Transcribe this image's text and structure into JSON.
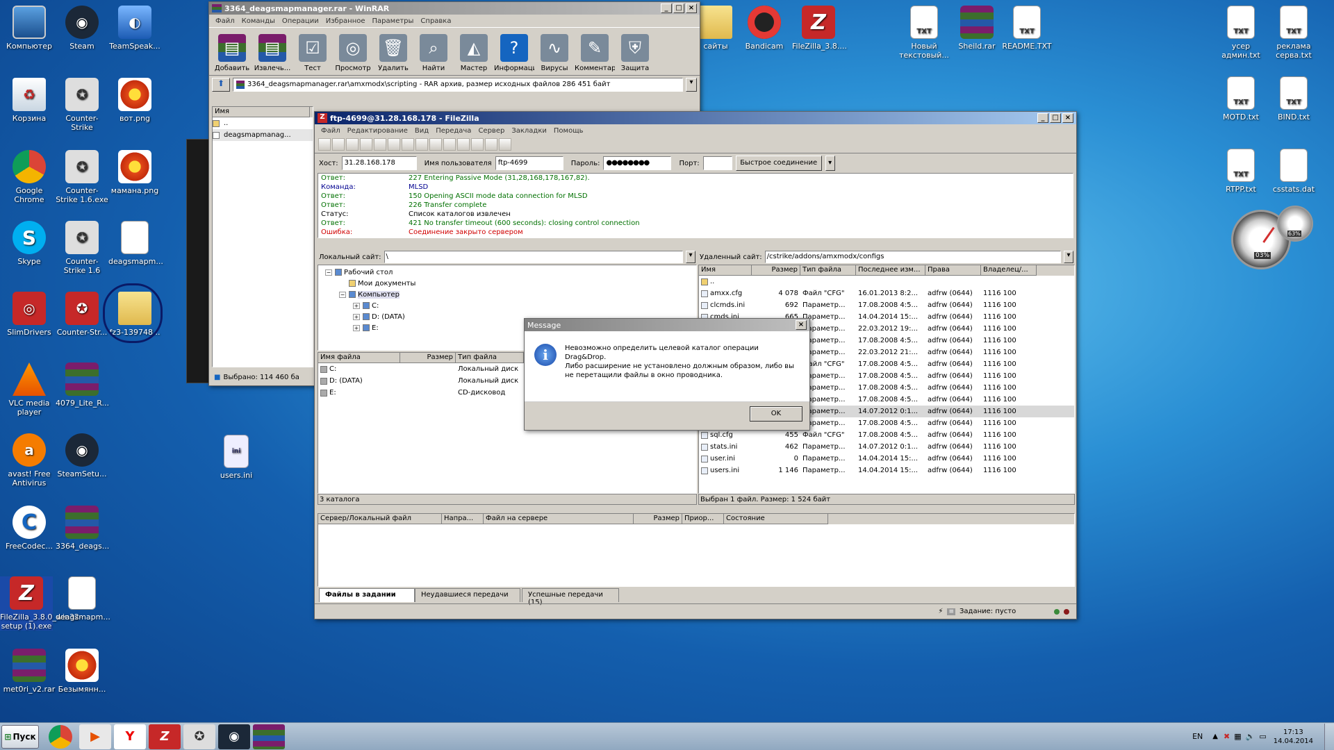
{
  "desktop_left": [
    {
      "id": "computer",
      "label": "Компьютер",
      "icon": "computer-icon",
      "cls": "mon",
      "glyph": ""
    },
    {
      "id": "steam",
      "label": "Steam",
      "icon": "steam-icon",
      "cls": "steam",
      "glyph": "◉"
    },
    {
      "id": "teamspeak",
      "label": "TeamSpeak...",
      "icon": "teamspeak-icon",
      "cls": "blue",
      "glyph": "◐"
    },
    {
      "id": "recycle",
      "label": "Корзина",
      "icon": "recycle-bin-icon",
      "cls": "trash",
      "glyph": "♻"
    },
    {
      "id": "cs",
      "label": "Counter-Strike",
      "icon": "counter-strike-icon",
      "cls": "cs",
      "glyph": "✪"
    },
    {
      "id": "vot",
      "label": "вот.png",
      "icon": "image-file-icon",
      "cls": "flower",
      "glyph": ""
    },
    {
      "id": "chrome",
      "label": "Google Chrome",
      "icon": "chrome-icon",
      "cls": "chrome",
      "glyph": ""
    },
    {
      "id": "cs16",
      "label": "Counter-Strike 1.6.exe",
      "icon": "counter-strike-icon",
      "cls": "cs",
      "glyph": "✪"
    },
    {
      "id": "mama",
      "label": "мамана.png",
      "icon": "image-file-icon",
      "cls": "flower",
      "glyph": ""
    },
    {
      "id": "skype",
      "label": "Skype",
      "icon": "skype-icon",
      "cls": "skype",
      "glyph": "S"
    },
    {
      "id": "cs16b",
      "label": "Counter-Strike 1.6",
      "icon": "counter-strike-icon",
      "cls": "cs",
      "glyph": "✪"
    },
    {
      "id": "deags",
      "label": "deagsmapm...",
      "icon": "file-icon",
      "cls": "file",
      "glyph": ""
    },
    {
      "id": "slim",
      "label": "SlimDrivers",
      "icon": "slimdrivers-icon",
      "cls": "red",
      "glyph": "◎"
    },
    {
      "id": "cstr",
      "label": "Counter-Str...",
      "icon": "counter-strike-icon",
      "cls": "red",
      "glyph": "✪"
    },
    {
      "id": "fz3",
      "label": "fz3-139748...",
      "icon": "folder-icon",
      "cls": "folder",
      "glyph": ""
    },
    {
      "id": "vlc",
      "label": "VLC media player",
      "icon": "vlc-icon",
      "cls": "vlc",
      "glyph": ""
    },
    {
      "id": "lite",
      "label": "4079_Lite_R...",
      "icon": "winrar-archive-icon",
      "cls": "rar",
      "glyph": ""
    },
    {
      "id": "avast",
      "label": "avast! Free Antivirus",
      "icon": "avast-icon",
      "cls": "avast",
      "glyph": "a"
    },
    {
      "id": "steamsetup",
      "label": "SteamSetu...",
      "icon": "steam-icon",
      "cls": "steam",
      "glyph": "◉"
    },
    {
      "id": "freecodec",
      "label": "FreeCodec...",
      "icon": "freecodec-icon",
      "cls": "cc",
      "glyph": "C"
    },
    {
      "id": "deagsrar",
      "label": "3364_deags...",
      "icon": "winrar-archive-icon",
      "cls": "rar",
      "glyph": ""
    },
    {
      "id": "fzsetup",
      "label": "FileZilla_3.8.0_win32-setup (1).exe",
      "icon": "filezilla-icon",
      "cls": "fz",
      "glyph": "Z"
    },
    {
      "id": "deagsmap2",
      "label": "deagsmapm...",
      "icon": "file-icon",
      "cls": "file",
      "glyph": ""
    },
    {
      "id": "met0ri",
      "label": "met0ri_v2.rar",
      "icon": "winrar-archive-icon",
      "cls": "rar",
      "glyph": ""
    },
    {
      "id": "bezym",
      "label": "Безымянн...",
      "icon": "image-file-icon",
      "cls": "flower",
      "glyph": ""
    },
    {
      "id": "usersini",
      "label": "users.ini",
      "icon": "ini-file-icon",
      "cls": "ini",
      "glyph": "ini"
    }
  ],
  "desktop_top": [
    {
      "id": "saity",
      "label": "сайты",
      "icon": "folder-icon",
      "cls": "folder",
      "glyph": ""
    },
    {
      "id": "bandicam",
      "label": "Bandicam",
      "icon": "bandicam-icon",
      "cls": "bandi",
      "glyph": ""
    },
    {
      "id": "fz38",
      "label": "FileZilla_3.8....",
      "icon": "filezilla-icon",
      "cls": "fz",
      "glyph": "Z"
    },
    {
      "id": "newtxt",
      "label": "Новый текстовый...",
      "icon": "txt-file-icon",
      "cls": "txt",
      "glyph": "TXT"
    },
    {
      "id": "sheild",
      "label": "Sheild.rar",
      "icon": "winrar-archive-icon",
      "cls": "rar",
      "glyph": ""
    },
    {
      "id": "readme",
      "label": "README.TXT",
      "icon": "txt-file-icon",
      "cls": "txt",
      "glyph": "TXT"
    },
    {
      "id": "usery",
      "label": "усер админ.txt",
      "icon": "txt-file-icon",
      "cls": "txt",
      "glyph": "TXT"
    },
    {
      "id": "reklama",
      "label": "реклама серва.txt",
      "icon": "txt-file-icon",
      "cls": "txt",
      "glyph": "TXT"
    },
    {
      "id": "motd",
      "label": "MOTD.txt",
      "icon": "txt-file-icon",
      "cls": "txt",
      "glyph": "TXT"
    },
    {
      "id": "bind",
      "label": "BIND.txt",
      "icon": "txt-file-icon",
      "cls": "txt",
      "glyph": "TXT"
    },
    {
      "id": "rtpp",
      "label": "RTPP.txt",
      "icon": "txt-file-icon",
      "cls": "txt",
      "glyph": "TXT"
    },
    {
      "id": "csstats",
      "label": "csstats.dat",
      "icon": "file-icon",
      "cls": "file",
      "glyph": ""
    }
  ],
  "gadget": {
    "cpu": "03%",
    "ram": "63%"
  },
  "winrar": {
    "title": "3364_deagsmapmanager.rar - WinRAR",
    "menu": [
      "Файл",
      "Команды",
      "Операции",
      "Избранное",
      "Параметры",
      "Справка"
    ],
    "toolbar": [
      "Добавить",
      "Извлечь...",
      "Тест",
      "Просмотр",
      "Удалить",
      "Найти",
      "Мастер",
      "Информация",
      "Вирусы",
      "Комментарий",
      "Защита"
    ],
    "path": "3364_deagsmapmanager.rar\\amxmodx\\scripting - RAR архив, размер исходных файлов 286 451 байт",
    "col_name": "Имя",
    "files": [
      "..",
      "deagsmapmanag..."
    ],
    "status": "Выбрано: 114 460 ба"
  },
  "filezilla": {
    "title": "ftp-4699@31.28.168.178 - FileZilla",
    "menu": [
      "Файл",
      "Редактирование",
      "Вид",
      "Передача",
      "Сервер",
      "Закладки",
      "Помощь"
    ],
    "host_label": "Хост:",
    "host": "31.28.168.178",
    "user_label": "Имя пользователя",
    "user": "ftp-4699",
    "pass_label": "Пароль:",
    "pass": "●●●●●●●●",
    "port_label": "Порт:",
    "port": "",
    "connect": "Быстрое соединение",
    "log": [
      {
        "k": "Ответ:",
        "v": "227 Entering Passive Mode (31,28,168,178,167,82).",
        "c": "#007000"
      },
      {
        "k": "Команда:",
        "v": "MLSD",
        "c": "#000090"
      },
      {
        "k": "Ответ:",
        "v": "150 Opening ASCII mode data connection for MLSD",
        "c": "#007000"
      },
      {
        "k": "Ответ:",
        "v": "226 Transfer complete",
        "c": "#007000"
      },
      {
        "k": "Статус:",
        "v": "Список каталогов извлечен",
        "c": "#000000"
      },
      {
        "k": "Ответ:",
        "v": "421 No transfer timeout (600 seconds): closing control connection",
        "c": "#007000"
      },
      {
        "k": "Ошибка:",
        "v": "Соединение закрыто сервером",
        "c": "#d00000"
      }
    ],
    "local_label": "Локальный сайт:",
    "local_path": "\\",
    "tree": [
      {
        "t": "Рабочий стол",
        "d": 0
      },
      {
        "t": "Мои документы",
        "d": 1
      },
      {
        "t": "Компьютер",
        "d": 1
      },
      {
        "t": "C:",
        "d": 2
      },
      {
        "t": "D: (DATA)",
        "d": 2
      },
      {
        "t": "E:",
        "d": 2
      }
    ],
    "local_cols": [
      "Имя файла",
      "Размер",
      "Тип файла"
    ],
    "local_files": [
      [
        "C:",
        "",
        "Локальный диск"
      ],
      [
        "D: (DATA)",
        "",
        "Локальный диск"
      ],
      [
        "E:",
        "",
        "CD-дисковод"
      ]
    ],
    "local_status": "3 каталога",
    "remote_label": "Удаленный сайт:",
    "remote_path": "/cstrike/addons/amxmodx/configs",
    "remote_cols": [
      "Имя",
      "Размер",
      "Тип файла",
      "Последнее изм...",
      "Права",
      "Владелец/..."
    ],
    "remote_files": [
      [
        "..",
        "",
        "",
        "",
        "",
        ""
      ],
      [
        "amxx.cfg",
        "4 078",
        "Файл \"CFG\"",
        "16.01.2013 8:2...",
        "adfrw (0644)",
        "1116 100"
      ],
      [
        "clcmds.ini",
        "692",
        "Параметр...",
        "17.08.2008 4:5...",
        "adfrw (0644)",
        "1116 100"
      ],
      [
        "cmds.ini",
        "665",
        "Параметр...",
        "14.04.2014 15:...",
        "adfrw (0644)",
        "1116 100"
      ],
      [
        "",
        "",
        "Параметр...",
        "22.03.2012 19:...",
        "adfrw (0644)",
        "1116 100"
      ],
      [
        "",
        "",
        "Параметр...",
        "17.08.2008 4:5...",
        "adfrw (0644)",
        "1116 100"
      ],
      [
        "",
        "",
        "Параметр...",
        "22.03.2012 21:...",
        "adfrw (0644)",
        "1116 100"
      ],
      [
        "",
        "",
        "Файл \"CFG\"",
        "17.08.2008 4:5...",
        "adfrw (0644)",
        "1116 100"
      ],
      [
        "",
        "",
        "Параметр...",
        "17.08.2008 4:5...",
        "adfrw (0644)",
        "1116 100"
      ],
      [
        "",
        "",
        "Параметр...",
        "17.08.2008 4:5...",
        "adfrw (0644)",
        "1116 100"
      ],
      [
        "",
        "",
        "Параметр...",
        "17.08.2008 4:5...",
        "adfrw (0644)",
        "1116 100"
      ],
      [
        "",
        "",
        "Параметр...",
        "14.07.2012 0:1...",
        "adfrw (0644)",
        "1116 100"
      ],
      [
        "",
        "",
        "Параметр...",
        "17.08.2008 4:5...",
        "adfrw (0644)",
        "1116 100"
      ],
      [
        "sql.cfg",
        "455",
        "Файл \"CFG\"",
        "17.08.2008 4:5...",
        "adfrw (0644)",
        "1116 100"
      ],
      [
        "stats.ini",
        "462",
        "Параметр...",
        "14.07.2012 0:1...",
        "adfrw (0644)",
        "1116 100"
      ],
      [
        "user.ini",
        "0",
        "Параметр...",
        "14.04.2014 15:...",
        "adfrw (0644)",
        "1116 100"
      ],
      [
        "users.ini",
        "1 146",
        "Параметр...",
        "14.04.2014 15:...",
        "adfrw (0644)",
        "1116 100"
      ]
    ],
    "remote_status": "Выбран 1 файл. Размер: 1 524 байт",
    "queue_cols": [
      "Сервер/Локальный файл",
      "Напра...",
      "Файл на сервере",
      "Размер",
      "Приор...",
      "Состояние"
    ],
    "tabs": [
      "Файлы в задании",
      "Неудавшиеся передачи",
      "Успешные передачи (15)"
    ],
    "queue_status": "Задание: пусто"
  },
  "dialog": {
    "title": "Message",
    "text1": "Невозможно определить целевой каталог операции Drag&Drop.",
    "text2": "Либо расширение не установлено должным образом, либо вы не перетащили файлы в окно проводника.",
    "ok": "OK"
  },
  "taskbar": {
    "start": "Пуск",
    "lang": "EN",
    "time": "17:13",
    "date": "14.04.2014"
  }
}
